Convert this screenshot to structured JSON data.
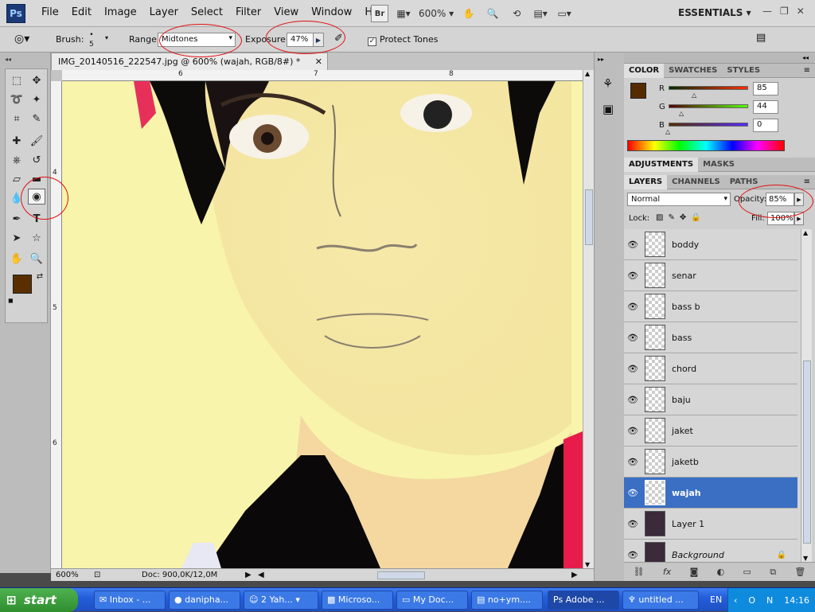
{
  "app": {
    "logo": "Ps"
  },
  "menu": [
    "File",
    "Edit",
    "Image",
    "Layer",
    "Select",
    "Filter",
    "View",
    "Window",
    "Help"
  ],
  "menu_tools": {
    "bridge": "Br",
    "zoom": "600%"
  },
  "workspace": {
    "label": "ESSENTIALS"
  },
  "window_controls": [
    "—",
    "❐",
    "✕"
  ],
  "options": {
    "brush_label": "Brush:",
    "brush_size": "5",
    "range_label": "Range:",
    "range_value": "Midtones",
    "exposure_label": "Exposure:",
    "exposure_value": "47%",
    "protect_label": "Protect Tones"
  },
  "document": {
    "tab_title": "IMG_20140516_222547.jpg @ 600% (wajah, RGB/8#) *",
    "ruler_top": [
      "6",
      "7",
      "8"
    ],
    "ruler_left": [
      "4",
      "5",
      "6"
    ],
    "zoom": "600%",
    "doc_info": "Doc: 900,0K/12,0M"
  },
  "color_panel": {
    "tabs": [
      "COLOR",
      "SWATCHES",
      "STYLES"
    ],
    "r_label": "R",
    "r_value": "85",
    "g_label": "G",
    "g_value": "44",
    "b_label": "B",
    "b_value": "0",
    "fg": "#552c00",
    "r_level": 0.33,
    "g_level": 0.17,
    "b_level": 0.0
  },
  "adjust_panel": {
    "tabs": [
      "ADJUSTMENTS",
      "MASKS"
    ]
  },
  "layers_panel": {
    "tabs": [
      "LAYERS",
      "CHANNELS",
      "PATHS"
    ],
    "blend_mode": "Normal",
    "opacity_label": "Opacity:",
    "opacity_value": "85%",
    "lock_label": "Lock:",
    "fill_label": "Fill:",
    "fill_value": "100%",
    "layers": [
      {
        "name": "boddy"
      },
      {
        "name": "senar"
      },
      {
        "name": "bass b"
      },
      {
        "name": "bass"
      },
      {
        "name": "chord"
      },
      {
        "name": "baju"
      },
      {
        "name": "jaket"
      },
      {
        "name": "jaketb"
      },
      {
        "name": "wajah"
      },
      {
        "name": "Layer 1"
      },
      {
        "name": "Background"
      }
    ],
    "footer_icons": [
      "link-icon",
      "fx-icon",
      "mask-icon",
      "adjustment-icon",
      "group-icon",
      "new-layer-icon",
      "trash-icon"
    ]
  },
  "taskbar": {
    "start": "start",
    "tasks": [
      "Inbox - ...",
      "danipha...",
      "2 Yah...",
      "Microso...",
      "My Doc...",
      "no+ym....",
      "Adobe ...",
      "untitled ..."
    ],
    "lang": "EN",
    "time": "14:16"
  }
}
